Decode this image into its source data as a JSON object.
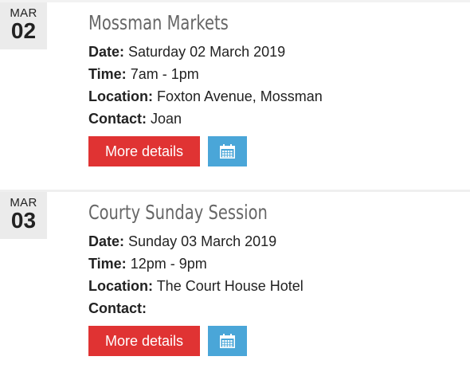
{
  "labels": {
    "date": "Date:",
    "time": "Time:",
    "location": "Location:",
    "contact": "Contact:",
    "more_details": "More details"
  },
  "icons": {
    "calendar": "calendar-icon"
  },
  "colors": {
    "more_button": "#e03333",
    "calendar_button": "#4aa6d8",
    "title": "#666666",
    "datebox": "#ebebeb"
  },
  "events": [
    {
      "month": "MAR",
      "day": "02",
      "title": "Mossman Markets",
      "date": "Saturday 02 March 2019",
      "time": "7am - 1pm",
      "location": "Foxton Avenue, Mossman",
      "contact": "Joan"
    },
    {
      "month": "MAR",
      "day": "03",
      "title": "Courty Sunday Session",
      "date": "Sunday 03 March 2019",
      "time": "12pm - 9pm",
      "location": "The Court House Hotel",
      "contact": ""
    }
  ]
}
